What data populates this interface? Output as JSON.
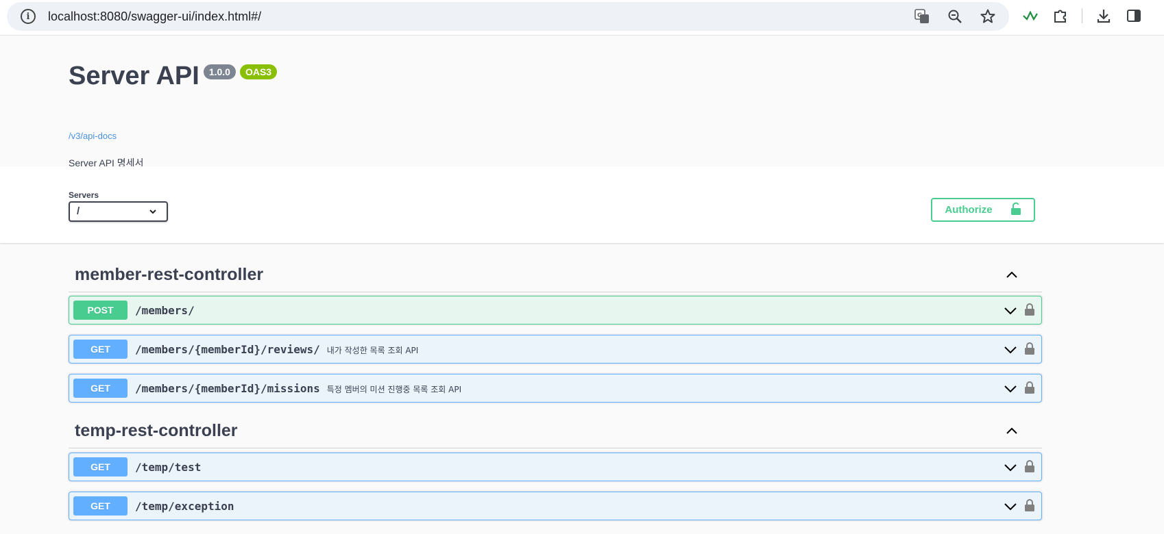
{
  "browser": {
    "url": "localhost:8080/swagger-ui/index.html#/"
  },
  "info": {
    "title": "Server API",
    "version": "1.0.0",
    "oas_badge": "OAS3",
    "docs_link": "/v3/api-docs",
    "description": "Server API 명세서"
  },
  "servers": {
    "label": "Servers",
    "selected": "/"
  },
  "authorize": {
    "label": "Authorize"
  },
  "tags": [
    {
      "name": "member-rest-controller",
      "operations": [
        {
          "method": "POST",
          "path": "/members/",
          "summary": ""
        },
        {
          "method": "GET",
          "path": "/members/{memberId}/reviews/",
          "summary": "내가 작성한 목록 조회 API"
        },
        {
          "method": "GET",
          "path": "/members/{memberId}/missions",
          "summary": "특정 멤버의 미션 진행중 목록 조회 API"
        }
      ]
    },
    {
      "name": "temp-rest-controller",
      "operations": [
        {
          "method": "GET",
          "path": "/temp/test",
          "summary": ""
        },
        {
          "method": "GET",
          "path": "/temp/exception",
          "summary": ""
        }
      ]
    }
  ],
  "colors": {
    "post": "#49cc90",
    "get": "#61affe",
    "post_bg": "#e8f6f0",
    "get_bg": "#ebf3fb"
  },
  "icons": {
    "site_info": "info-icon",
    "translate": "translate-icon",
    "zoom": "zoom-icon",
    "bookmark": "star-icon",
    "extension": "puzzle-icon",
    "download": "download-icon",
    "sidepanel": "side-panel-icon",
    "collapse": "chevron-up-icon",
    "expand": "chevron-down-icon",
    "lock": "lock-icon"
  }
}
